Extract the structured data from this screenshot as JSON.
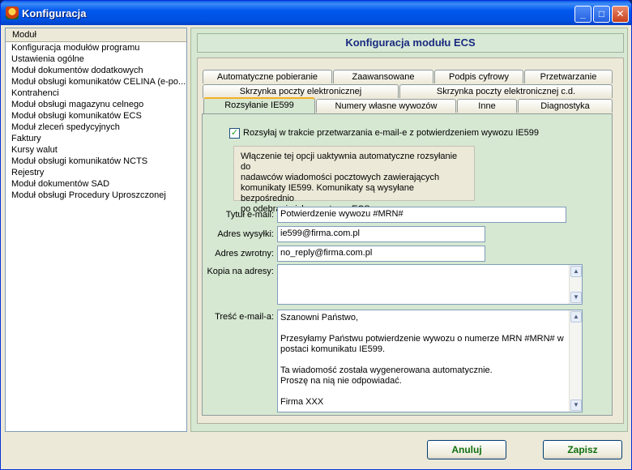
{
  "window": {
    "title": "Konfiguracja",
    "icon": "app-icon",
    "buttons": {
      "minimize": "_",
      "maximize": "□",
      "close": "✕"
    }
  },
  "sidebar": {
    "header": "Moduł",
    "items": [
      "Konfiguracja modułów programu",
      "Ustawienia ogólne",
      "Moduł dokumentów dodatkowych",
      "Moduł obsługi komunikatów CELINA (e-po...",
      "Kontrahenci",
      "Moduł obsługi magazynu celnego",
      "Moduł obsługi komunikatów ECS",
      "Moduł zleceń spedycyjnych",
      "Faktury",
      "Kursy walut",
      "Moduł obsługi komunikatów NCTS",
      "Rejestry",
      "Moduł dokumentów SAD",
      "Moduł obsługi Procedury Uproszczonej"
    ]
  },
  "main": {
    "header": "Konfiguracja modułu ECS",
    "tabs_row1": [
      "Automatyczne pobieranie",
      "Zaawansowane",
      "Podpis cyfrowy",
      "Przetwarzanie"
    ],
    "tabs_row2": [
      "Skrzynka poczty elektronicznej",
      "Skrzynka poczty elektronicznej c.d."
    ],
    "tabs_row3": [
      "Rozsyłanie IE599",
      "Numery własne wywozów",
      "Inne",
      "Diagnostyka"
    ],
    "active_tab": "Rozsyłanie IE599"
  },
  "form": {
    "checkbox_label": "Rozsyłaj w trakcie przetwarzania e-mail-e z potwierdzeniem wywozu IE599",
    "checkbox_checked": true,
    "info_lines": [
      "Włączenie tej opcji uaktywnia automatyczne rozsyłanie do",
      "nadawców wiadomości pocztowych zawierających",
      "komunikaty IE599. Komunikaty są wysyłane bezpośrednio",
      "po odebraniu ich z systemu ECS."
    ],
    "title_label": "Tytuł e-mail:",
    "title_value": "Potwierdzenie wywozu #MRN#",
    "sender_label": "Adres wysyłki:",
    "sender_value": "ie599@firma.com.pl",
    "reply_label": "Adres zwrotny:",
    "reply_value": "no_reply@firma.com.pl",
    "cc_label": "Kopia na adresy:",
    "cc_value": "",
    "body_label": "Treść e-mail-a:",
    "body_lines": [
      "Szanowni Państwo,",
      "",
      "Przesyłamy Państwu potwierdzenie wywozu o numerze MRN #MRN#  w",
      "postaci komunikatu IE599.",
      "",
      "Ta wiadomość została wygenerowana automatycznie.",
      "Proszę na nią nie odpowiadać.",
      "",
      "Firma XXX"
    ]
  },
  "footer": {
    "cancel_label": "Anuluj",
    "save_label": "Zapisz"
  }
}
